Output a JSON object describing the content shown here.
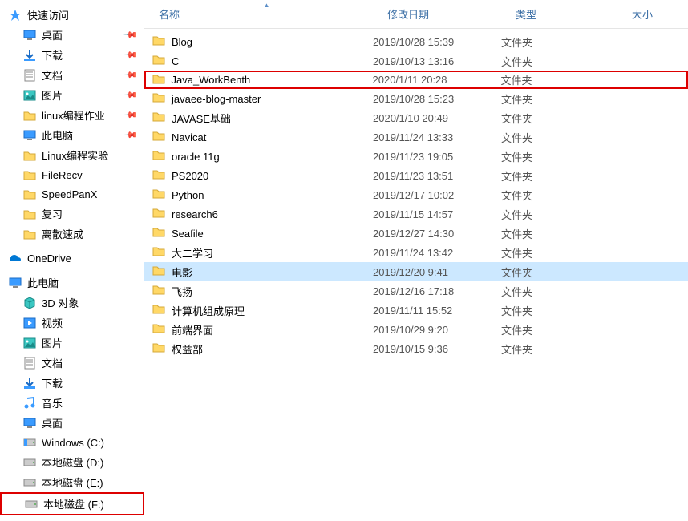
{
  "columns": {
    "name": "名称",
    "date": "修改日期",
    "type": "类型",
    "size": "大小"
  },
  "sidebar": {
    "quick_access": "快速访问",
    "quick_items": [
      {
        "label": "桌面",
        "icon": "desktop",
        "pinned": true
      },
      {
        "label": "下载",
        "icon": "downloads",
        "pinned": true
      },
      {
        "label": "文档",
        "icon": "documents",
        "pinned": true
      },
      {
        "label": "图片",
        "icon": "pictures",
        "pinned": true
      },
      {
        "label": "linux编程作业",
        "icon": "folder",
        "pinned": true
      },
      {
        "label": "此电脑",
        "icon": "thispc",
        "pinned": true
      },
      {
        "label": "Linux编程实验",
        "icon": "folder"
      },
      {
        "label": "FileRecv",
        "icon": "folder"
      },
      {
        "label": "SpeedPanX",
        "icon": "folder"
      },
      {
        "label": "复习",
        "icon": "folder"
      },
      {
        "label": "离散速成",
        "icon": "folder"
      }
    ],
    "onedrive": "OneDrive",
    "thispc": "此电脑",
    "pc_items": [
      {
        "label": "3D 对象",
        "icon": "3d"
      },
      {
        "label": "视频",
        "icon": "videos"
      },
      {
        "label": "图片",
        "icon": "pictures"
      },
      {
        "label": "文档",
        "icon": "documents"
      },
      {
        "label": "下载",
        "icon": "downloads"
      },
      {
        "label": "音乐",
        "icon": "music"
      },
      {
        "label": "桌面",
        "icon": "desktop"
      },
      {
        "label": "Windows (C:)",
        "icon": "drive-c"
      },
      {
        "label": "本地磁盘 (D:)",
        "icon": "drive"
      },
      {
        "label": "本地磁盘 (E:)",
        "icon": "drive"
      },
      {
        "label": "本地磁盘 (F:)",
        "icon": "drive",
        "redbox": true
      }
    ]
  },
  "files": [
    {
      "name": "Blog",
      "date": "2019/10/28 15:39",
      "type": "文件夹"
    },
    {
      "name": "C",
      "date": "2019/10/13 13:16",
      "type": "文件夹"
    },
    {
      "name": "Java_WorkBenth",
      "date": "2020/1/11 20:28",
      "type": "文件夹",
      "highlight": true
    },
    {
      "name": "javaee-blog-master",
      "date": "2019/10/28 15:23",
      "type": "文件夹"
    },
    {
      "name": "JAVASE基础",
      "date": "2020/1/10 20:49",
      "type": "文件夹"
    },
    {
      "name": "Navicat",
      "date": "2019/11/24 13:33",
      "type": "文件夹"
    },
    {
      "name": "oracle 11g",
      "date": "2019/11/23 19:05",
      "type": "文件夹"
    },
    {
      "name": "PS2020",
      "date": "2019/11/23 13:51",
      "type": "文件夹"
    },
    {
      "name": "Python",
      "date": "2019/12/17 10:02",
      "type": "文件夹"
    },
    {
      "name": "research6",
      "date": "2019/11/15 14:57",
      "type": "文件夹"
    },
    {
      "name": "Seafile",
      "date": "2019/12/27 14:30",
      "type": "文件夹"
    },
    {
      "name": "大二学习",
      "date": "2019/11/24 13:42",
      "type": "文件夹"
    },
    {
      "name": "电影",
      "date": "2019/12/20 9:41",
      "type": "文件夹",
      "selected": true
    },
    {
      "name": "飞扬",
      "date": "2019/12/16 17:18",
      "type": "文件夹"
    },
    {
      "name": "计算机组成原理",
      "date": "2019/11/11 15:52",
      "type": "文件夹"
    },
    {
      "name": "前端界面",
      "date": "2019/10/29 9:20",
      "type": "文件夹"
    },
    {
      "name": "权益部",
      "date": "2019/10/15 9:36",
      "type": "文件夹"
    }
  ]
}
